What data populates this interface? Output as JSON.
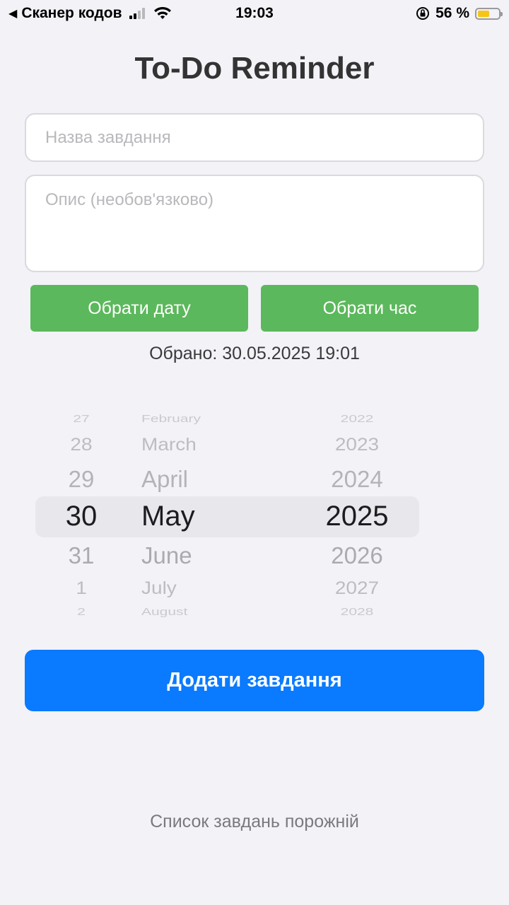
{
  "status_bar": {
    "back_label": "Сканер кодов",
    "time": "19:03",
    "battery_percent": "56 %",
    "battery_level": 0.56,
    "battery_color": "#f5c518"
  },
  "header": {
    "title": "To-Do Reminder"
  },
  "form": {
    "title_placeholder": "Назва завдання",
    "description_placeholder": "Опис (необов'язково)",
    "pick_date_label": "Обрати дату",
    "pick_time_label": "Обрати час",
    "selected_text": "Обрано: 30.05.2025 19:01",
    "add_button_label": "Додати завдання"
  },
  "picker": {
    "days": [
      "27",
      "28",
      "29",
      "30",
      "31",
      "1",
      "2"
    ],
    "months": [
      "February",
      "March",
      "April",
      "May",
      "June",
      "July",
      "August"
    ],
    "years": [
      "2022",
      "2023",
      "2024",
      "2025",
      "2026",
      "2027",
      "2028"
    ]
  },
  "task_list": {
    "empty_text": "Список завдань порожній"
  },
  "colors": {
    "green_button": "#5cb85c",
    "primary_blue": "#0a7aff",
    "background": "#f2f2f7"
  }
}
